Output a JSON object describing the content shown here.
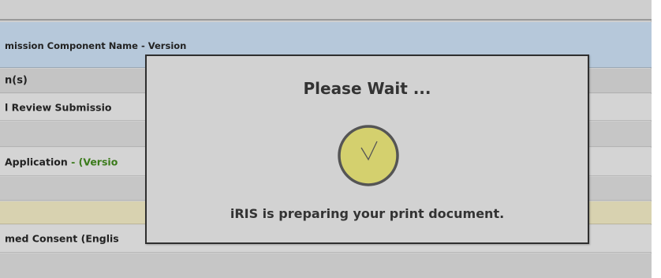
{
  "table": {
    "header_label": "mission Component Name - Version",
    "category_label": "n(s)",
    "submission_label": "l Review Submissio",
    "application_label": "Application",
    "application_version_prefix": " - (Versio",
    "consent_label": "med Consent (Englis",
    "consent_suffix": "("
  },
  "modal": {
    "title": "Please Wait ...",
    "message": "iRIS is preparing your print document.",
    "icon": "clock-icon",
    "icon_color": "#d4d06e"
  }
}
